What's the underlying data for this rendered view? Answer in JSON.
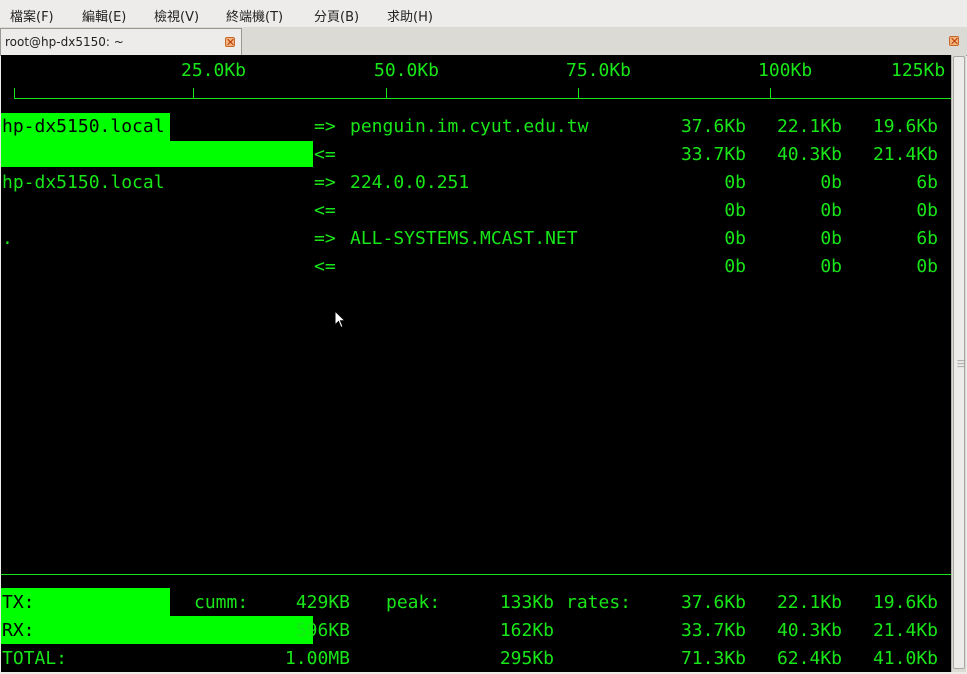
{
  "menu": [
    {
      "label": "檔案(F)"
    },
    {
      "label": "編輯(E)"
    },
    {
      "label": "檢視(V)"
    },
    {
      "label": "終端機(T)"
    },
    {
      "label": "分頁(B)"
    },
    {
      "label": "求助(H)"
    }
  ],
  "tab": {
    "title": "root@hp-dx5150: ~"
  },
  "scale": {
    "ticks": [
      "25.0Kb",
      "50.0Kb",
      "75.0Kb",
      "100Kb",
      "125Kb"
    ]
  },
  "rows": [
    {
      "host": "hp-dx5150.local",
      "dir": "=>",
      "peer": "penguin.im.cyut.edu.tw",
      "r1": "37.6Kb",
      "r2": "22.1Kb",
      "r3": "19.6Kb"
    },
    {
      "host": "",
      "dir": "<=",
      "peer": "",
      "r1": "33.7Kb",
      "r2": "40.3Kb",
      "r3": "21.4Kb"
    },
    {
      "host": "hp-dx5150.local",
      "dir": "=>",
      "peer": "224.0.0.251",
      "r1": "0b",
      "r2": "0b",
      "r3": "6b"
    },
    {
      "host": "",
      "dir": "<=",
      "peer": "",
      "r1": "0b",
      "r2": "0b",
      "r3": "0b"
    },
    {
      "host": ".",
      "dir": "=>",
      "peer": "ALL-SYSTEMS.MCAST.NET",
      "r1": "0b",
      "r2": "0b",
      "r3": "6b"
    },
    {
      "host": "",
      "dir": "<=",
      "peer": "",
      "r1": "0b",
      "r2": "0b",
      "r3": "0b"
    }
  ],
  "totals": {
    "tx_label": "TX:",
    "rx_label": "RX:",
    "total_label": "TOTAL:",
    "cumm_label": "cumm:",
    "peak_label": "peak:",
    "rates_label": "rates:",
    "tx_cumm": "429KB",
    "rx_cumm": "596KB",
    "total_cumm": "1.00MB",
    "tx_peak": "133Kb",
    "rx_peak": "162Kb",
    "total_peak": "295Kb",
    "tx_rates": [
      "37.6Kb",
      "22.1Kb",
      "19.6Kb"
    ],
    "rx_rates": [
      "33.7Kb",
      "40.3Kb",
      "21.4Kb"
    ],
    "total_rates": [
      "71.3Kb",
      "62.4Kb",
      "41.0Kb"
    ]
  },
  "colors": {
    "terminal_bg": "#000000",
    "text": "#19e619",
    "bar": "#00ff00"
  },
  "bars": {
    "scale_max_kb": 125,
    "row1_out_kb": 37.6,
    "row1_in_kb": 33.7,
    "tx_fraction_of_row": 0.54,
    "rx_fraction_of_row": 1.0
  }
}
